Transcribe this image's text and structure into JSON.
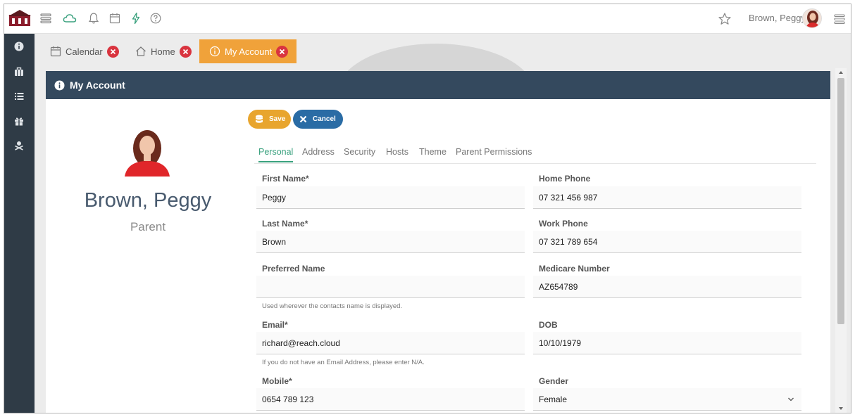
{
  "topbar": {
    "icons": [
      "hamburger-icon",
      "cloud-icon",
      "bell-icon",
      "calendar-icon",
      "lightning-icon",
      "help-icon"
    ],
    "user_name": "Brown, Peggy",
    "colors": {
      "cloud": "#3aa17e",
      "lightning": "#3aa17e"
    }
  },
  "sidebar": {
    "icons": [
      "info-icon",
      "briefcase-icon",
      "list-icon",
      "gift-icon",
      "user-settings-icon"
    ],
    "color": "#2f3b46"
  },
  "tabs": [
    {
      "label": "Calendar",
      "icon": "calendar-icon"
    },
    {
      "label": "Home",
      "icon": "home-icon"
    },
    {
      "label": "My Account",
      "icon": "info-circle-icon",
      "active": true
    }
  ],
  "panel": {
    "title": "My Account",
    "header_color": "#34495e"
  },
  "profile": {
    "name": "Brown, Peggy",
    "role": "Parent"
  },
  "buttons": {
    "save": "Save",
    "cancel": "Cancel"
  },
  "form_tabs": [
    "Personal",
    "Address",
    "Security",
    "Hosts",
    "Theme",
    "Parent Permissions"
  ],
  "form": {
    "first_name": {
      "label": "First Name*",
      "value": "Peggy"
    },
    "last_name": {
      "label": "Last Name*",
      "value": "Brown"
    },
    "preferred_name": {
      "label": "Preferred Name",
      "value": "",
      "help": "Used wherever the contacts name is displayed."
    },
    "email": {
      "label": "Email*",
      "value": "richard@reach.cloud",
      "help": "If you do not have an Email Address, please enter N/A."
    },
    "mobile": {
      "label": "Mobile*",
      "value": "0654 789 123"
    },
    "home_phone": {
      "label": "Home Phone",
      "value": "07 321 456 987"
    },
    "work_phone": {
      "label": "Work Phone",
      "value": "07 321 789 654"
    },
    "medicare": {
      "label": "Medicare Number",
      "value": "AZ654789"
    },
    "dob": {
      "label": "DOB",
      "value": "10/10/1979"
    },
    "gender": {
      "label": "Gender",
      "value": "Female"
    }
  }
}
